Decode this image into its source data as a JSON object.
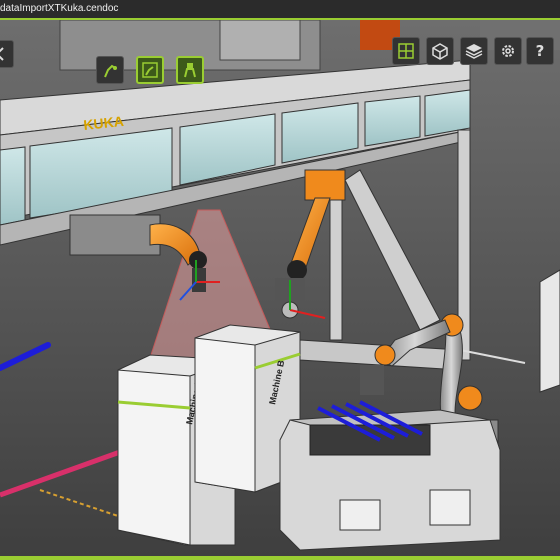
{
  "window": {
    "title": "dataImportXTKuka.cendoc"
  },
  "toolbar_left": [
    {
      "name": "robot-tool-icon",
      "active": false
    },
    {
      "name": "robot-program-icon",
      "active": true
    },
    {
      "name": "gripper-tool-icon",
      "active": true
    }
  ],
  "toolbar_right": [
    {
      "name": "layout-grid-icon"
    },
    {
      "name": "cube-view-icon"
    },
    {
      "name": "layers-icon"
    },
    {
      "name": "gear-icon"
    },
    {
      "name": "help-icon",
      "label": "?"
    }
  ],
  "scene": {
    "gantry_logo": "KUKA",
    "machine_a": "Machine A",
    "machine_b": "Machine B"
  },
  "colors": {
    "accent": "#9acd32",
    "robot_orange": "#f08a1c",
    "background": "#5a5a5a",
    "laser_blue": "#1d1dd8",
    "laser_pink": "#d8306a",
    "machine_white": "#eeeeee",
    "cone_red": "#e7a0a0"
  }
}
